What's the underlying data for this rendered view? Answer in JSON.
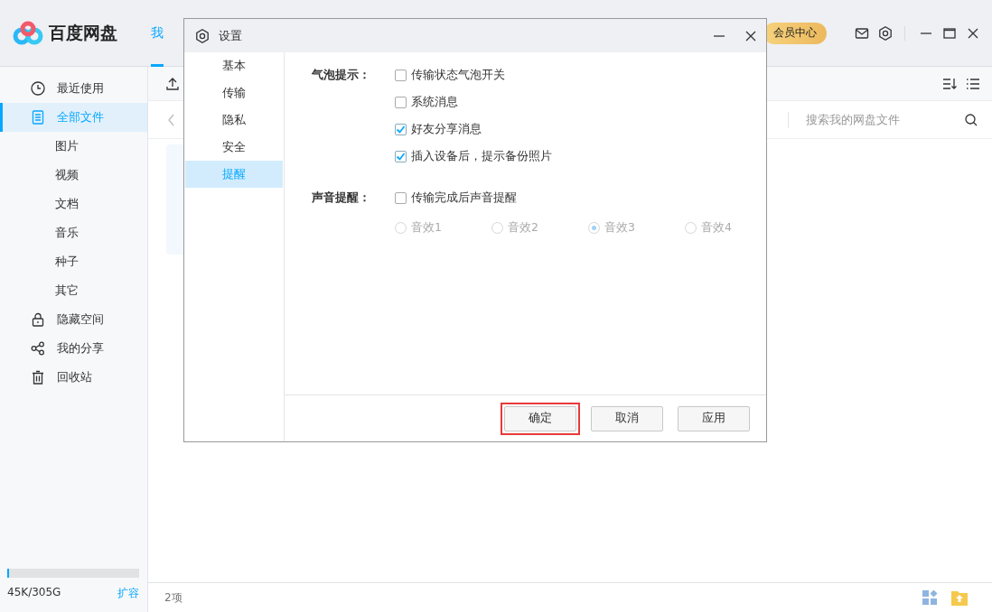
{
  "app": {
    "logo_text": "百度网盘",
    "nav_tab": {
      "label": "我",
      "selected": true
    },
    "vip_button": "会员中心"
  },
  "sidebar": {
    "items": [
      {
        "label": "最近使用",
        "selected": false
      },
      {
        "label": "全部文件",
        "selected": true,
        "children": [
          {
            "label": "图片",
            "selected": false
          },
          {
            "label": "视频",
            "selected": false
          },
          {
            "label": "文档",
            "selected": false
          },
          {
            "label": "音乐",
            "selected": false
          },
          {
            "label": "种子",
            "selected": false
          },
          {
            "label": "其它",
            "selected": false
          }
        ]
      },
      {
        "label": "隐藏空间",
        "selected": false
      },
      {
        "label": "我的分享",
        "selected": false
      },
      {
        "label": "回收站",
        "selected": false
      }
    ],
    "storage": {
      "level": 0.012,
      "text": "45K/305G",
      "link": "扩容"
    }
  },
  "search": {
    "placeholder": "搜索我的网盘文件"
  },
  "status_bar": {
    "count": "2项"
  },
  "dialog": {
    "title": "设置",
    "nav": [
      {
        "label": "基本",
        "selected": false
      },
      {
        "label": "传输",
        "selected": false
      },
      {
        "label": "隐私",
        "selected": false
      },
      {
        "label": "安全",
        "selected": false
      },
      {
        "label": "提醒",
        "selected": true
      }
    ],
    "sections": [
      {
        "label": "气泡提示：",
        "options": [
          {
            "label": "传输状态气泡开关",
            "checked": false
          },
          {
            "label": "系统消息",
            "checked": false
          },
          {
            "label": "好友分享消息",
            "checked": true
          },
          {
            "label": "插入设备后，提示备份照片",
            "checked": true
          }
        ]
      },
      {
        "label": "声音提醒：",
        "options": [
          {
            "label": "传输完成后声音提醒",
            "checked": false
          }
        ],
        "radios_disabled": true,
        "radios": [
          {
            "label": "音效1",
            "selected": false
          },
          {
            "label": "音效2",
            "selected": false
          },
          {
            "label": "音效3",
            "selected": true
          },
          {
            "label": "音效4",
            "selected": false
          }
        ]
      }
    ],
    "buttons": [
      {
        "label": "确定",
        "highlighted": true
      },
      {
        "label": "取消",
        "highlighted": false
      },
      {
        "label": "应用",
        "highlighted": false
      }
    ]
  }
}
